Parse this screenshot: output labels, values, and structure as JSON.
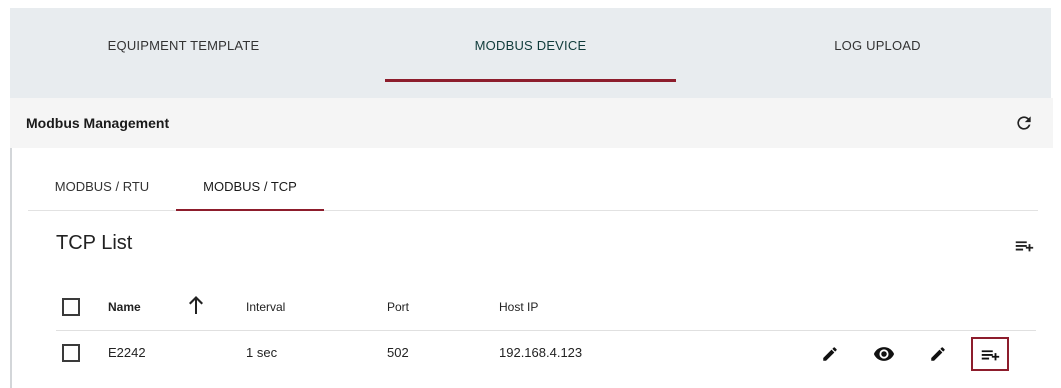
{
  "top_tabs": [
    {
      "label": "EQUIPMENT TEMPLATE"
    },
    {
      "label": "MODBUS DEVICE"
    },
    {
      "label": "LOG UPLOAD"
    }
  ],
  "card": {
    "title": "Modbus Management",
    "refresh_icon": "refresh-icon"
  },
  "sub_tabs": [
    {
      "label": "MODBUS / RTU"
    },
    {
      "label": "MODBUS / TCP"
    }
  ],
  "list": {
    "title": "TCP List",
    "add_icon": "playlist-add-icon"
  },
  "table": {
    "columns": [
      "Name",
      "Interval",
      "Port",
      "Host IP"
    ],
    "sort_icon": "arrow-up-icon",
    "rows": [
      {
        "name": "E2242",
        "interval": "1 sec",
        "port": "502",
        "host_ip": "192.168.4.123"
      }
    ],
    "row_actions": [
      "pencil-icon",
      "eye-icon",
      "pencil-icon",
      "playlist-add-icon"
    ]
  },
  "colors": {
    "accent": "#8d1d2c",
    "tab_bar": "#e8ecef",
    "header_bg": "#f5f5f5"
  }
}
